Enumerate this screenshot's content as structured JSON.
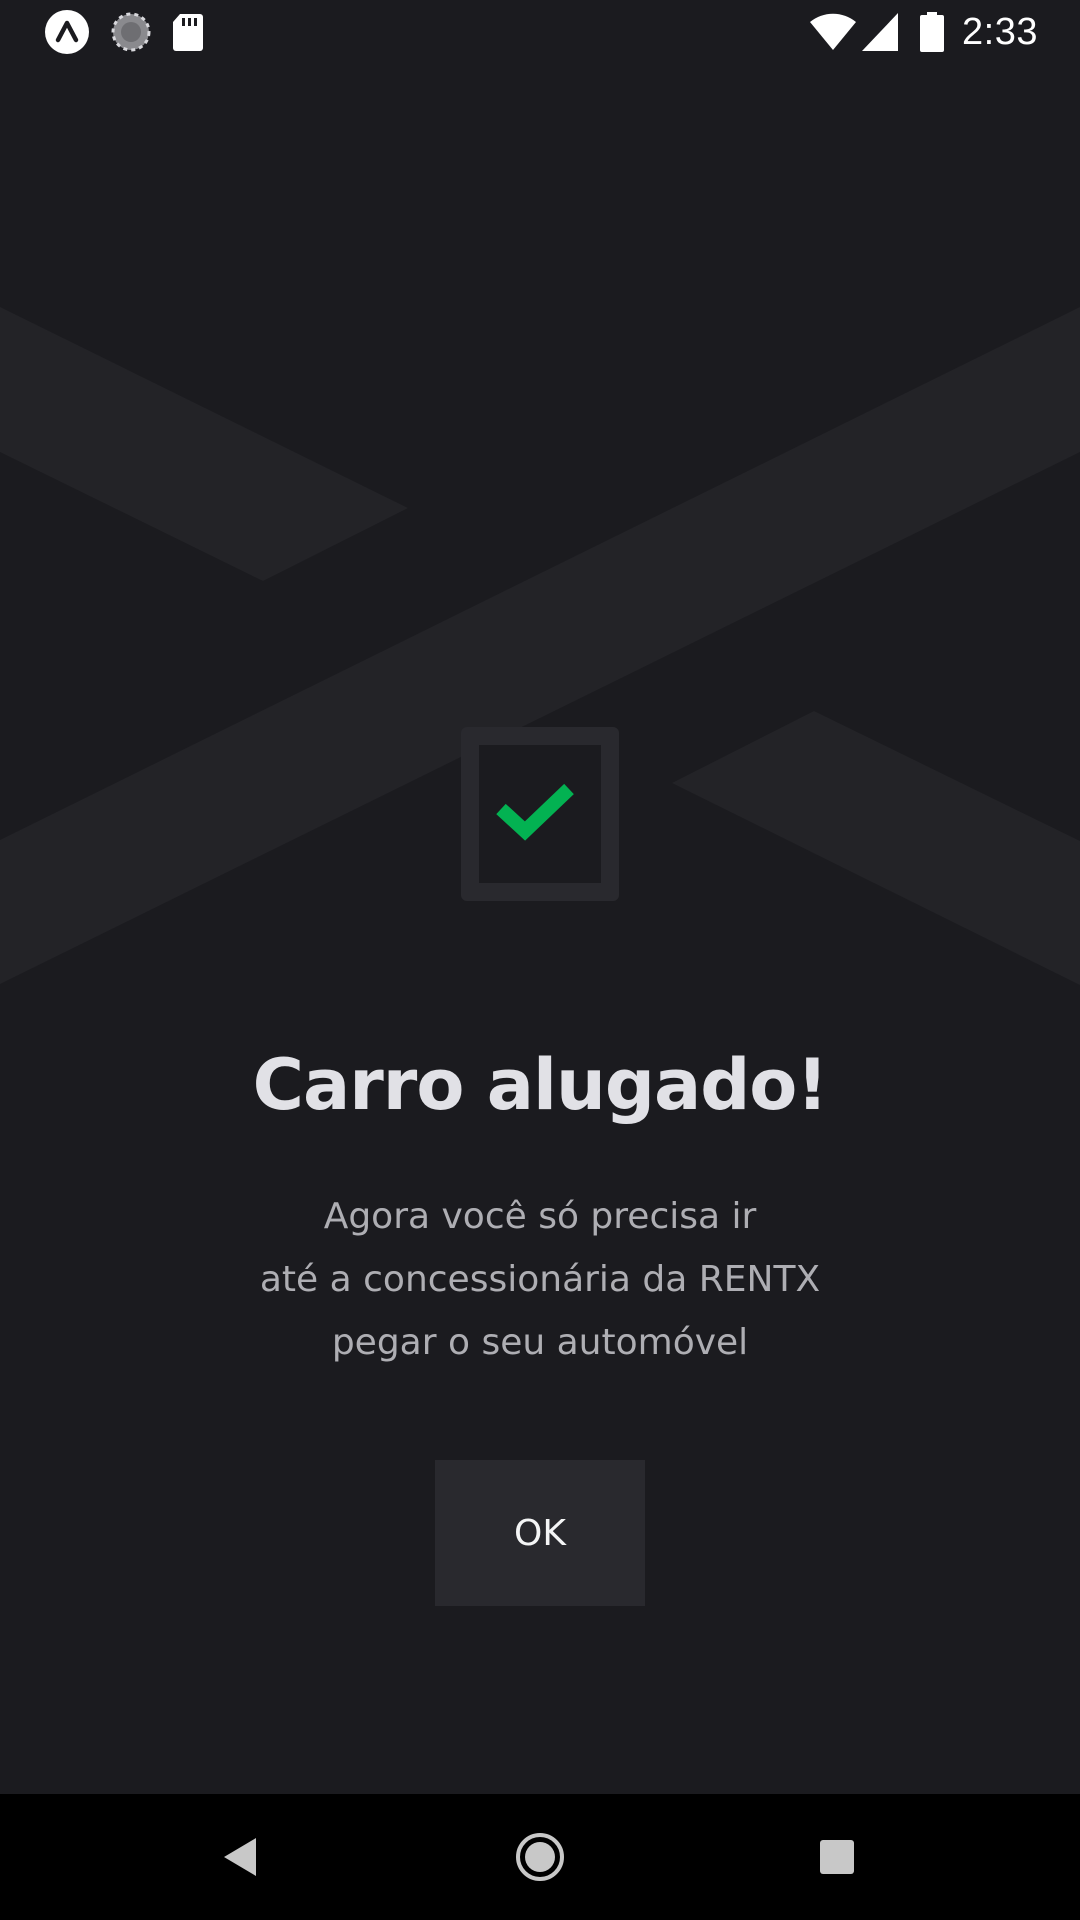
{
  "status_bar": {
    "time": "2:33",
    "left_icons": [
      "expo-icon",
      "sync-icon",
      "sd-card-icon"
    ],
    "right_icons": [
      "wifi-icon",
      "cell-signal-icon",
      "battery-icon"
    ]
  },
  "success": {
    "icon": "checkmark-icon",
    "title": "Carro alugado!",
    "message_lines": [
      "Agora você só precisa ir",
      "até a concessionária da RENTX",
      "pegar o seu automóvel"
    ],
    "ok_label": "OK"
  },
  "nav_bar": {
    "buttons": [
      "back-icon",
      "home-icon",
      "recents-icon"
    ]
  },
  "colors": {
    "background": "#1b1b1f",
    "logo_shape": "#232327",
    "title": "#e1e1e6",
    "text": "#aeaeb3",
    "button": "#29292e",
    "check": "#03b252",
    "nav_bar": "#000000"
  }
}
